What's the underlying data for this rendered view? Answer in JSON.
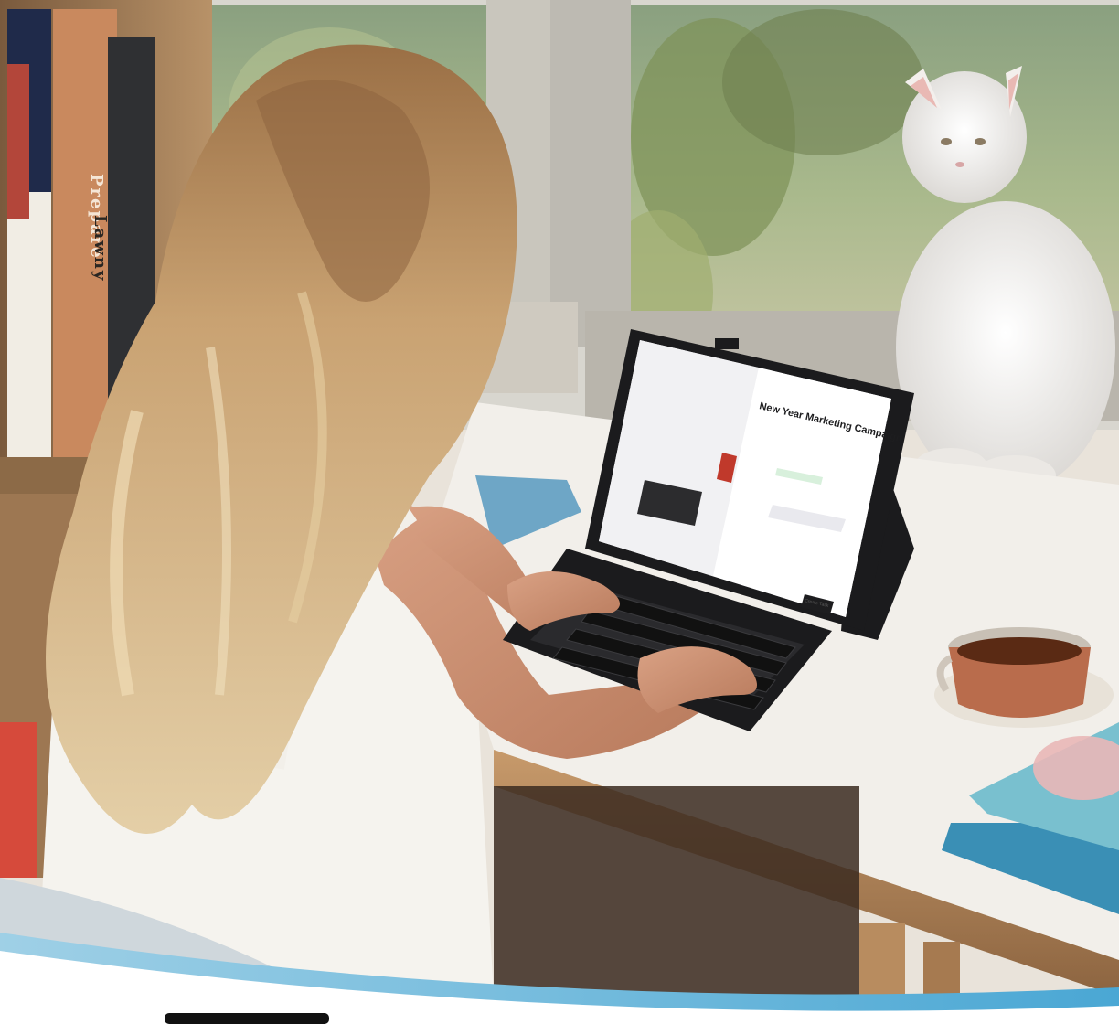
{
  "book_spines": {
    "book1": "Prepare",
    "book2": "Lawny"
  },
  "tablet": {
    "title": "New Year Marketing Campaign",
    "button_label": "Create Task"
  },
  "colors": {
    "window_green": "#8fa66a",
    "desk_white": "#f2efea",
    "tablet_black": "#1b1b1d",
    "tea_brown": "#5a2a14",
    "accent_blue": "#6cb8da"
  }
}
